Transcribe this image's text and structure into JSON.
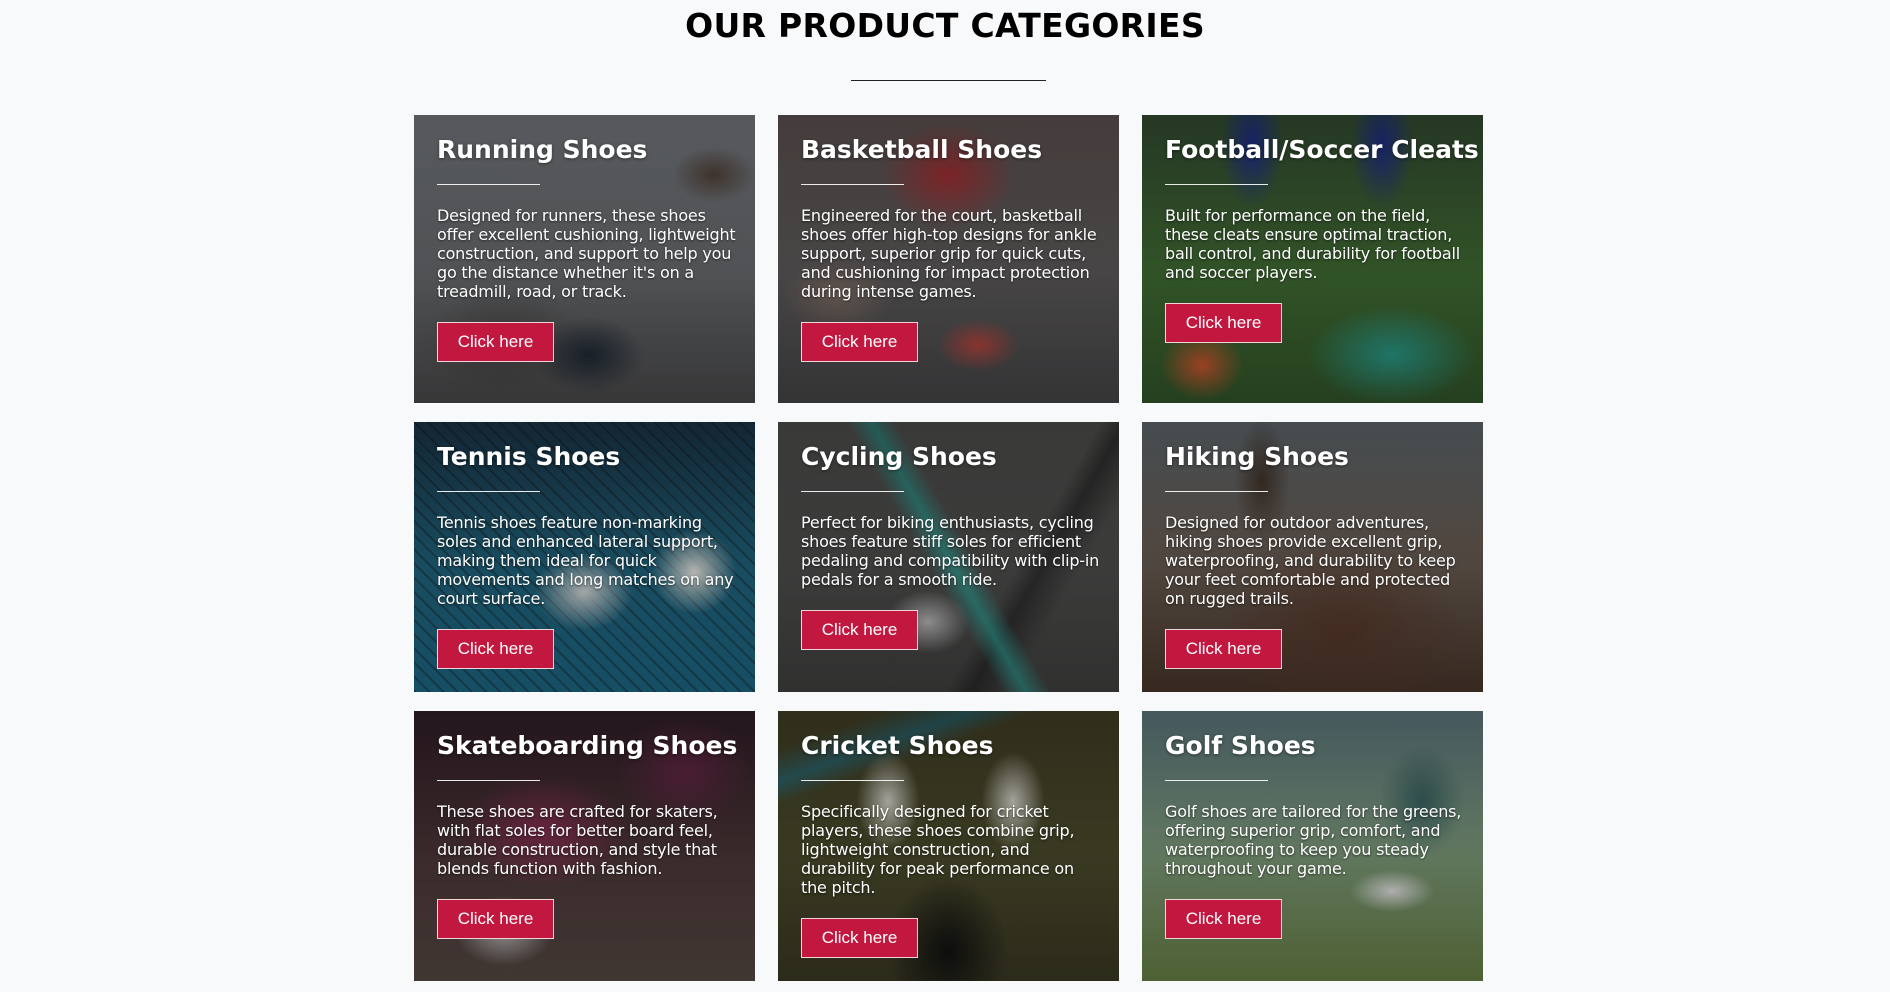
{
  "page": {
    "heading": "OUR PRODUCT CATEGORIES"
  },
  "categories": [
    {
      "title": "Running Shoes",
      "description": "Designed for runners, these shoes offer excellent cushioning, lightweight construction, and support to help you go the distance whether it's on a treadmill, road, or track.",
      "button_label": "Click here"
    },
    {
      "title": "Basketball Shoes",
      "description": "Engineered for the court, basketball shoes offer high-top designs for ankle support, superior grip for quick cuts, and cushioning for impact protection during intense games.",
      "button_label": "Click here"
    },
    {
      "title": "Football/Soccer Cleats",
      "description": "Built for performance on the field, these cleats ensure optimal traction, ball control, and durability for football and soccer players.",
      "button_label": "Click here"
    },
    {
      "title": "Tennis Shoes",
      "description": "Tennis shoes feature non-marking soles and enhanced lateral support, making them ideal for quick movements and long matches on any court surface.",
      "button_label": "Click here"
    },
    {
      "title": "Cycling Shoes",
      "description": "Perfect for biking enthusiasts, cycling shoes feature stiff soles for efficient pedaling and compatibility with clip-in pedals for a smooth ride.",
      "button_label": "Click here"
    },
    {
      "title": "Hiking Shoes",
      "description": "Designed for outdoor adventures, hiking shoes provide excellent grip, waterproofing, and durability to keep your feet comfortable and protected on rugged trails.",
      "button_label": "Click here"
    },
    {
      "title": "Skateboarding Shoes",
      "description": "These shoes are crafted for skaters, with flat soles for better board feel, durable construction, and style that blends function with fashion.",
      "button_label": "Click here"
    },
    {
      "title": "Cricket Shoes",
      "description": "Specifically designed for cricket players, these shoes combine grip, lightweight construction, and durability for peak performance on the pitch.",
      "button_label": "Click here"
    },
    {
      "title": "Golf Shoes",
      "description": "Golf shoes are tailored for the greens, offering superior grip, comfort, and waterproofing to keep you steady throughout your game.",
      "button_label": "Click here"
    }
  ],
  "colors": {
    "button_background": "#c2173f",
    "page_background": "#f8f9fb",
    "heading_text": "#000000"
  }
}
